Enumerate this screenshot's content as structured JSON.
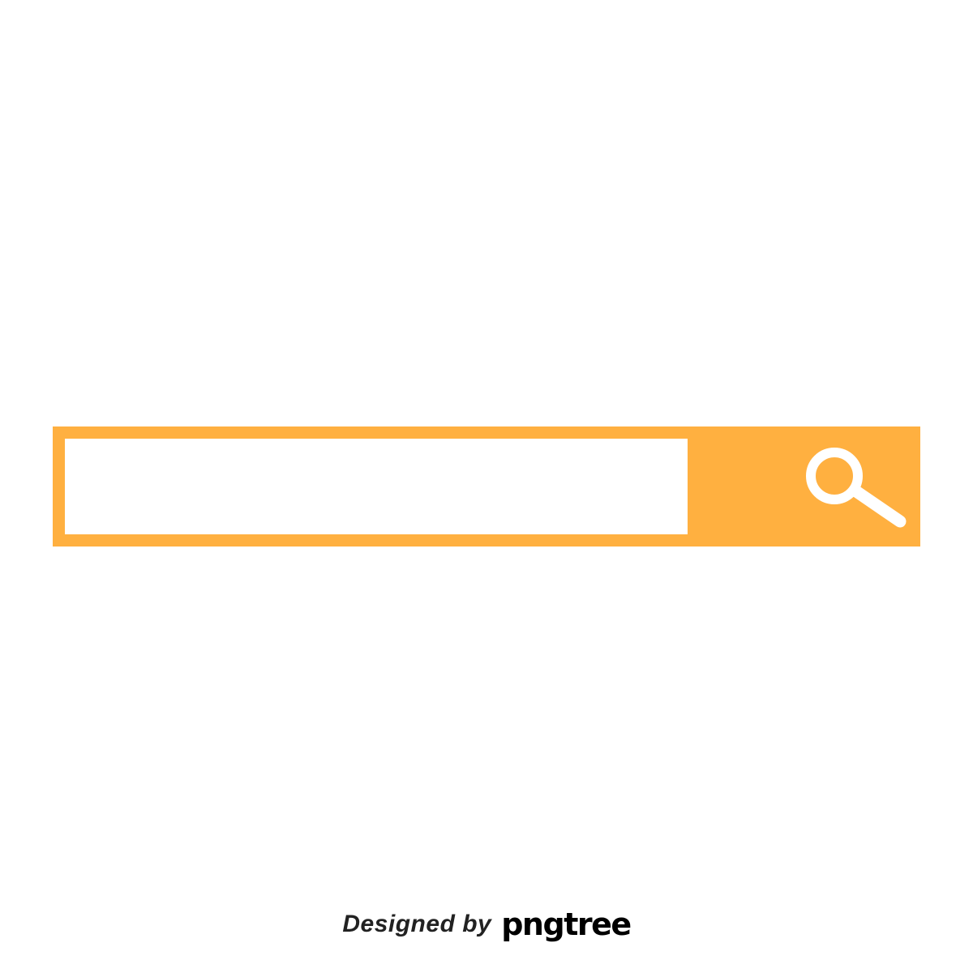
{
  "search": {
    "value": "",
    "placeholder": "",
    "icon": "search-icon"
  },
  "watermark": {
    "prefix": "Designed by",
    "brand": "pngtree"
  },
  "colors": {
    "accent": "#ffb040",
    "field_background": "#ffffff",
    "icon": "#ffffff",
    "watermark_text": "#222222"
  }
}
